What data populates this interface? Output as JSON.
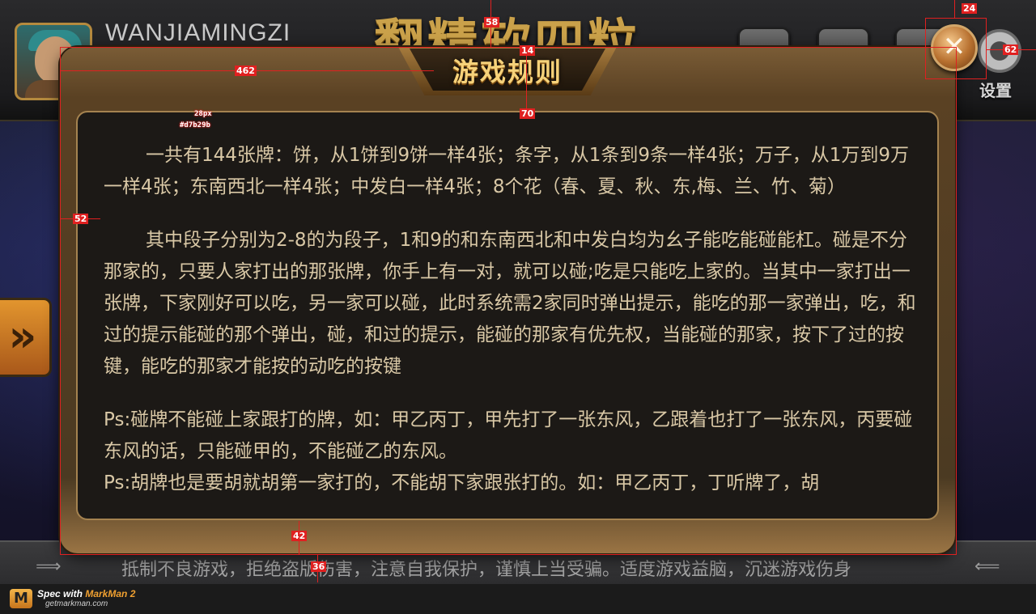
{
  "header": {
    "player_name": "WANJIAMINGZI",
    "game_title": "翻精软四粒",
    "settings_label": "设置"
  },
  "icons": {
    "avatar": "player-avatar",
    "close": "close-icon",
    "settings": "gear-icon",
    "side_arrow": "double-chevron-right-icon"
  },
  "dialog": {
    "title": "游戏规则",
    "close_glyph": "✕",
    "paragraphs": [
      "一共有144张牌：饼，从1饼到9饼一样4张；条字，从1条到9条一样4张；万子，从1万到9万一样4张；东南西北一样4张；中发白一样4张；8个花（春、夏、秋、东,梅、兰、竹、菊）",
      "其中段子分别为2-8的为段子，1和9的和东南西北和中发白均为幺子能吃能碰能杠。碰是不分那家的，只要人家打出的那张牌，你手上有一对，就可以碰;吃是只能吃上家的。当其中一家打出一张牌，下家刚好可以吃，另一家可以碰，此时系统需2家同时弹出提示，能吃的那一家弹出，吃，和过的提示能碰的那个弹出，碰，和过的提示，能碰的那家有优先权，当能碰的那家，按下了过的按键，能吃的那家才能按的动吃的按键",
      "Ps:碰牌不能碰上家跟打的牌，如：甲乙丙丁，甲先打了一张东风，乙跟着也打了一张东风，丙要碰东风的话，只能碰甲的，不能碰乙的东风。",
      "Ps:胡牌也是要胡就胡第一家打的，不能胡下家跟张打的。如：甲乙丙丁，丁听牌了，胡"
    ]
  },
  "footer": {
    "notice": "抵制不良游戏，拒绝盗版伤害，注意自我保护，谨慎上当受骗。适度游戏益脑，沉迷游戏伤身",
    "ornament_left": "⟹",
    "ornament_right": "⟸"
  },
  "watermark": {
    "brand_prefix": "Spec with ",
    "brand_name": "MarkMan 2",
    "site": "getmarkman.com"
  },
  "spec_annotations": {
    "close_top": "24",
    "close_right": "62",
    "title_top": "58",
    "title_gap": "14",
    "title_left": "462",
    "panel_top": "70",
    "panel_left": "52",
    "panel_bottom": "42",
    "notice_gap": "36",
    "font_size": "28px",
    "font_color": "#d7b29b"
  },
  "colors": {
    "rules_text": "#d9c8a6",
    "title_gold": "#f6d27a",
    "spec_red": "#e02020"
  }
}
